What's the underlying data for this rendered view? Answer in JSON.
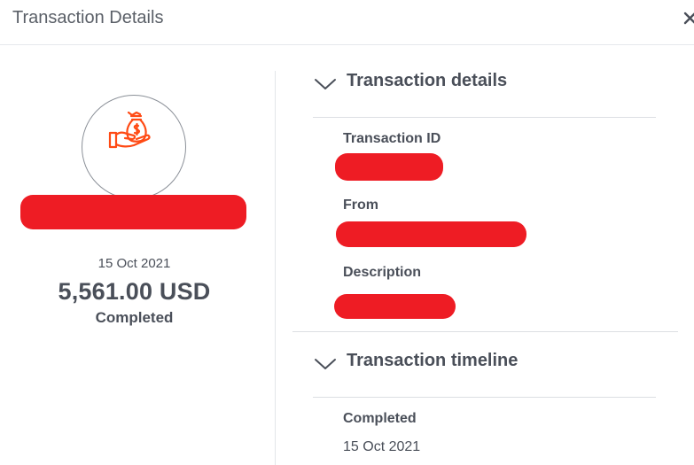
{
  "header": {
    "title": "Transaction Details",
    "close_icon": "close-icon"
  },
  "summary": {
    "icon": "money-bag-hand-icon",
    "icon_color": "#ff4a14",
    "date": "15 Oct 2021",
    "amount": "5,561.00 USD",
    "status": "Completed"
  },
  "details": {
    "title": "Transaction details",
    "fields": [
      {
        "label": "Transaction ID"
      },
      {
        "label": "From"
      },
      {
        "label": "Description"
      }
    ]
  },
  "timeline": {
    "title": "Transaction timeline",
    "events": [
      {
        "label": "Completed",
        "date": "15 Oct 2021"
      }
    ]
  },
  "colors": {
    "redaction": "#ee1c24",
    "text": "#4a4f59",
    "divider": "#dcdfe3"
  }
}
